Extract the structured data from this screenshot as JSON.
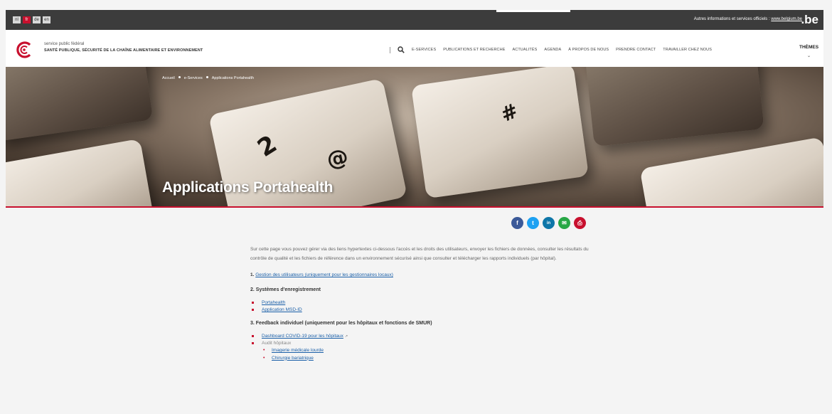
{
  "topbar": {
    "languages": [
      "nl",
      "fr",
      "de",
      "en"
    ],
    "active_language": "fr",
    "official_text": "Autres informations et services officiels : ",
    "official_link": "www.belgium.be",
    "be_logo": ".be"
  },
  "header": {
    "org_line1": "service public fédéral",
    "org_line2": "SANTÉ PUBLIQUE, SÉCURITÉ DE LA CHAÎNE ALIMENTAIRE ET ENVIRONNEMENT",
    "nav": [
      "E-SERVICES",
      "PUBLICATIONS ET RECHERCHE",
      "ACTUALITÉS",
      "AGENDA",
      "À PROPOS DE NOUS",
      "PRENDRE CONTACT",
      "TRAVAILLER CHEZ NOUS"
    ],
    "themes": "THÈMES",
    "accent_color": "#c8102e"
  },
  "hero": {
    "breadcrumb": [
      "Accueil",
      "e-Services",
      "Applications Portahealth"
    ],
    "title": "Applications Portahealth",
    "keys": [
      "2",
      "@",
      "#"
    ]
  },
  "share": [
    {
      "icon": "facebook-icon",
      "glyph": "f",
      "color": "#3b5998"
    },
    {
      "icon": "twitter-icon",
      "glyph": "t",
      "color": "#1da1f2"
    },
    {
      "icon": "linkedin-icon",
      "glyph": "in",
      "color": "#0e76a8"
    },
    {
      "icon": "email-icon",
      "glyph": "✉",
      "color": "#27a745"
    },
    {
      "icon": "print-icon",
      "glyph": "⎙",
      "color": "#c8102e"
    }
  ],
  "content": {
    "intro": "Sur cette page vous pouvez gérer via des liens hypertextes ci-dessous l'accès et les droits des utilisateurs, envoyer les fichiers de données, consulter les résultats du contrôle de qualité et les fichiers de référence dans un environnement sécurisé ainsi que consulter et télécharger les rapports individuels (par hôpital).",
    "item1_number": "1.",
    "item1_link": "Gestion des utilisateurs (uniquement pour les gestionnaires locaux)",
    "section2": "2. Systèmes d'enregistrement",
    "section2_links": [
      "Portahealth",
      "Application MSD-ID"
    ],
    "section3": "3. Feedback individuel (uniquement pour les hôpitaux et fonctions de SMUR)",
    "section3_link": "Dashboard COVID-19 pour les hôpitaux",
    "section3_static": "Audit hôpitaux",
    "section3_sub": [
      "Imagerie médicale lourde",
      "Chirurgie bariatrique"
    ]
  }
}
